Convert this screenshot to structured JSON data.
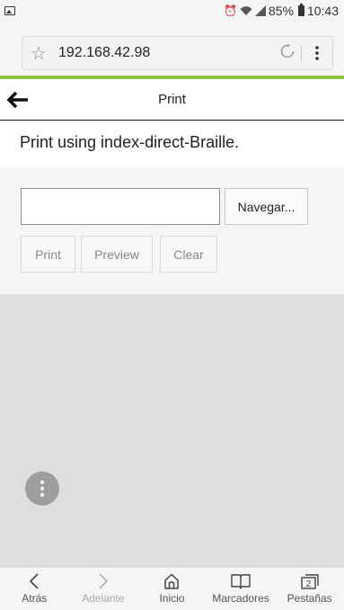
{
  "status_bar": {
    "battery": "85%",
    "time": "10:43"
  },
  "browser": {
    "url": "192.168.42.98"
  },
  "page": {
    "title": "Print",
    "intro": "Print using index-direct-Braille."
  },
  "form": {
    "file_value": "",
    "browse_label": "Navegar...",
    "print_label": "Print",
    "preview_label": "Preview",
    "clear_label": "Clear"
  },
  "bottom_nav": {
    "back": "Atrás",
    "forward": "Adelante",
    "home": "Inicio",
    "bookmarks": "Marcadores",
    "tabs": "Pestañas",
    "tab_count": "2"
  },
  "colors": {
    "load_bar": "#8cc63f",
    "content_gray": "#dedede"
  }
}
